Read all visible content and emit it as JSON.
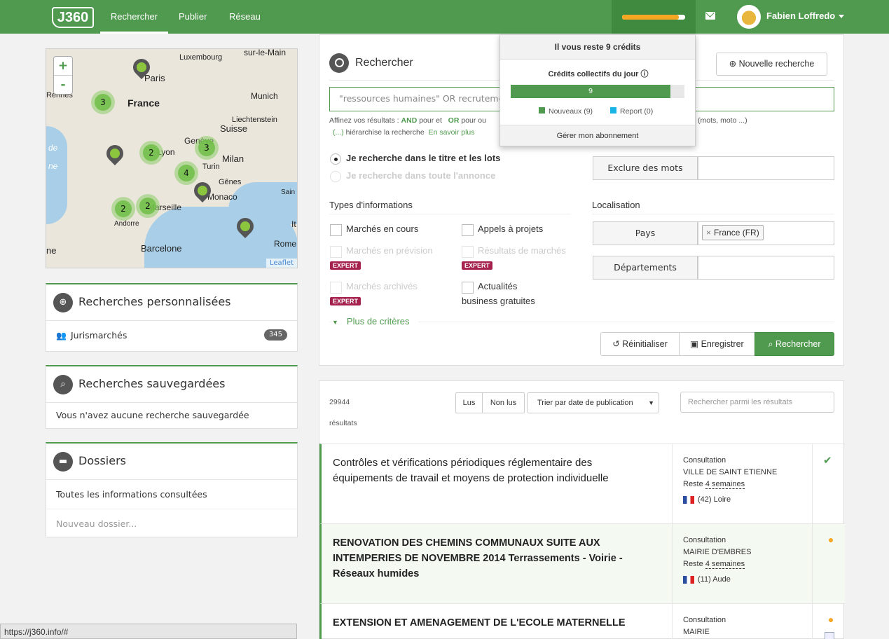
{
  "nav": {
    "logo": "J360",
    "items": [
      "Rechercher",
      "Publier",
      "Réseau"
    ],
    "user": "Fabien Loffredo",
    "credit_fraction": 0.9
  },
  "map": {
    "labels": [
      "Luxembourg",
      "sur-le-Main",
      "Paris",
      "Rennes",
      "Munich",
      "France",
      "Liechtenstein",
      "Suisse",
      "Genève",
      "Lyon",
      "Milan",
      "Turin",
      "Gênes",
      "Monaco",
      "Marseille",
      "Andorre",
      "Barcelone",
      "Rome",
      "Sain",
      "It",
      "ne",
      "de",
      "ne"
    ],
    "clusters": [
      "3",
      "2",
      "3",
      "4",
      "2",
      "2"
    ],
    "attribution": "Leaflet",
    "zoom_in": "+",
    "zoom_out": "-"
  },
  "sidebar": {
    "custom": {
      "title": "Recherches personnalisées",
      "item": "Jurismarchés",
      "count": "345"
    },
    "saved": {
      "title": "Recherches sauvegardées",
      "empty": "Vous n'avez aucune recherche sauvegardée"
    },
    "folders": {
      "title": "Dossiers",
      "all": "Toutes les informations consultées",
      "new": "Nouveau dossier..."
    }
  },
  "search": {
    "title": "Rechercher",
    "new_search": "Nouvelle recherche",
    "placeholder": "\"ressources humaines\" OR recrutement",
    "hint1a": "Affinez vos résultats :",
    "and": "AND",
    "hint1b": "pour et",
    "or": "OR",
    "hint1c": "pour ou",
    "hint1d": "(mots, moto ...)",
    "hint2a": "(...)",
    "hint2b": "hiérarchise la recherche",
    "learn": "En savoir plus",
    "radio1": "Je recherche dans le titre et les lots",
    "radio2": "Je recherche dans toute l'annonce",
    "exclude": "Exclure des mots",
    "types_title": "Types d'informations",
    "loc_title": "Localisation",
    "types": [
      "Marchés en cours",
      "Appels à projets",
      "Marchés en prévision",
      "Résultats de marchés",
      "Marchés archivés",
      "Actualités",
      "business gratuites"
    ],
    "expert": "EXPERT",
    "pays": "Pays",
    "pays_tag": "France (FR)",
    "departements": "Départements",
    "more": "Plus de critères",
    "reset": "Réinitialiser",
    "save": "Enregistrer",
    "submit": "Rechercher"
  },
  "results": {
    "count": "29944",
    "count_label": "résultats",
    "read": "Lus",
    "unread": "Non lus",
    "sort": "Trier par date de publication",
    "filter_placeholder": "Rechercher parmi les résultats",
    "items": [
      {
        "title": "Contrôles et vérifications périodiques réglementaire des équipements de travail et moyens de protection individuelle",
        "type": "Consultation",
        "buyer": "VILLE DE SAINT ETIENNE",
        "remain": "Reste",
        "remain_val": "4 semaines",
        "dept": "(42) Loire"
      },
      {
        "title": "RENOVATION DES CHEMINS COMMUNAUX SUITE AUX INTEMPERIES DE NOVEMBRE 2014 Terrassements - Voirie - Réseaux humides",
        "type": "Consultation",
        "buyer": "MAIRIE D'EMBRES",
        "remain": "Reste",
        "remain_val": "4 semaines",
        "dept": "(11) Aude"
      },
      {
        "title": "EXTENSION ET AMENAGEMENT DE L'ECOLE MATERNELLE",
        "type": "Consultation",
        "buyer": "MAIRIE"
      }
    ]
  },
  "popup": {
    "remaining": "Il vous reste 9 crédits",
    "daily": "Crédits collectifs du jour",
    "bar_value": "9",
    "bar_fraction": 0.92,
    "new": "Nouveaux (9)",
    "report": "Report (0)",
    "manage": "Gérer mon abonnement",
    "colors": {
      "new": "#4f9a4e",
      "report": "#1ab3e6"
    }
  },
  "status": "https://j360.info/#"
}
